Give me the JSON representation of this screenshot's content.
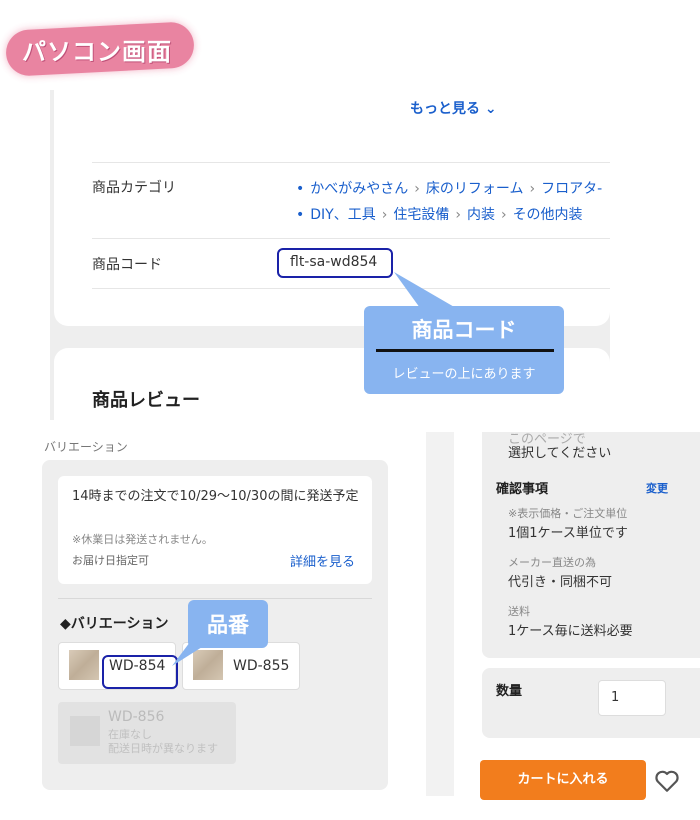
{
  "badge": {
    "text": "パソコン画面"
  },
  "product_info": {
    "more_link": "もっと見る",
    "category_label": "商品カテゴリ",
    "categories_line1": [
      "かべがみやさん",
      "床のリフォーム",
      "フロアタ-"
    ],
    "categories_line2": [
      "DIY、工具",
      "住宅設備",
      "内装",
      "その他内装"
    ],
    "code_label": "商品コード",
    "code_value": "flt-sa-wd854",
    "review_title": "商品レビュー"
  },
  "callout_code": {
    "title": "商品コード",
    "subtitle": "レビューの上にあります"
  },
  "variation": {
    "header": "バリエーション",
    "shipping_text": "14時までの注文で10/29〜10/30の間に発送予定",
    "holiday_note": "※休業日は発送されません。",
    "date_note": "お届け日指定可",
    "detail_link": "詳細を見る",
    "section_title": "◆バリエーション",
    "options": [
      {
        "name": "WD-854"
      },
      {
        "name": "WD-855"
      }
    ],
    "disabled_option": {
      "name": "WD-856",
      "status1": "在庫なし",
      "status2": "配送日時が異なります"
    }
  },
  "callout_part": {
    "text": "品番"
  },
  "right_column": {
    "cut_text": "このページで",
    "select_text": "選択してください",
    "confirm_title": "確認事項",
    "change_link": "変更",
    "price_note": "※表示価格・ご注文単位",
    "price_value": "1個1ケース単位です",
    "maker_note": "メーカー直送の為",
    "maker_value": "代引き・同梱不可",
    "shipping_note": "送料",
    "shipping_value": "1ケース毎に送料必要",
    "qty_label": "数量",
    "qty_value": "1",
    "cart_button": "カートに入れる"
  },
  "colors": {
    "link": "#1a5fcc",
    "callout": "#88b4f0",
    "highlight": "#1a22a8",
    "cart": "#f27d1d",
    "badge": "#e87a9a"
  }
}
